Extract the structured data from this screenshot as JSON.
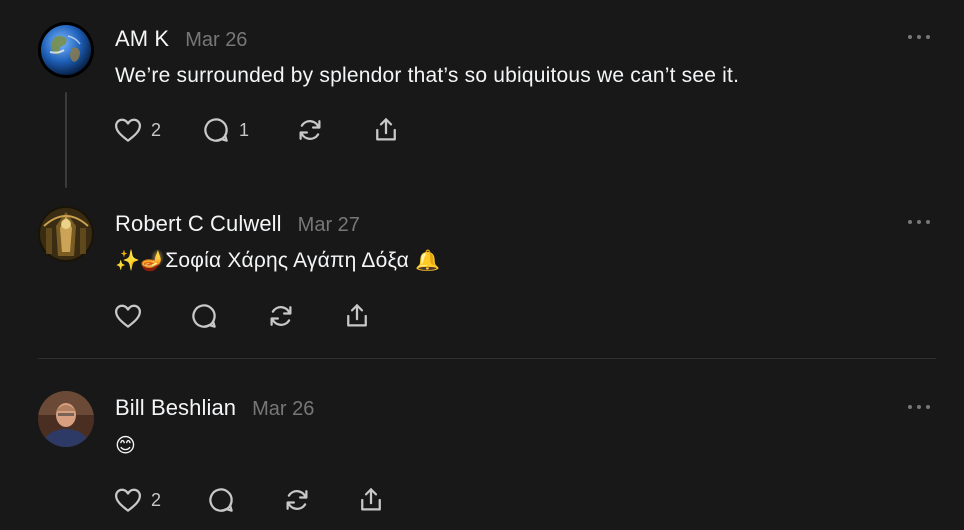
{
  "posts": [
    {
      "author": "AM K",
      "date": "Mar 26",
      "text": "We’re surrounded by splendor that’s so ubiquitous we can’t see it.",
      "avatar_icon": "earth-globe-avatar",
      "likes": "2",
      "replies": "1"
    },
    {
      "author": "Robert C Culwell",
      "date": "Mar 27",
      "text_prefix_emoji": "✨🪔",
      "text": "Σοφία Χάρης Αγάπη Δόξα",
      "text_suffix_emoji": "🔔",
      "avatar_icon": "ornate-interior-avatar"
    },
    {
      "author": "Bill Beshlian",
      "date": "Mar 26",
      "text": "😊",
      "avatar_icon": "man-portrait-avatar",
      "likes": "2"
    }
  ],
  "icons": {
    "like": "heart-icon",
    "reply": "comment-icon",
    "repost": "repost-icon",
    "share": "share-icon",
    "more": "more-options-icon"
  },
  "colors": {
    "background": "#181818",
    "primary_text": "#f3f5f7",
    "secondary_text": "#777777"
  }
}
